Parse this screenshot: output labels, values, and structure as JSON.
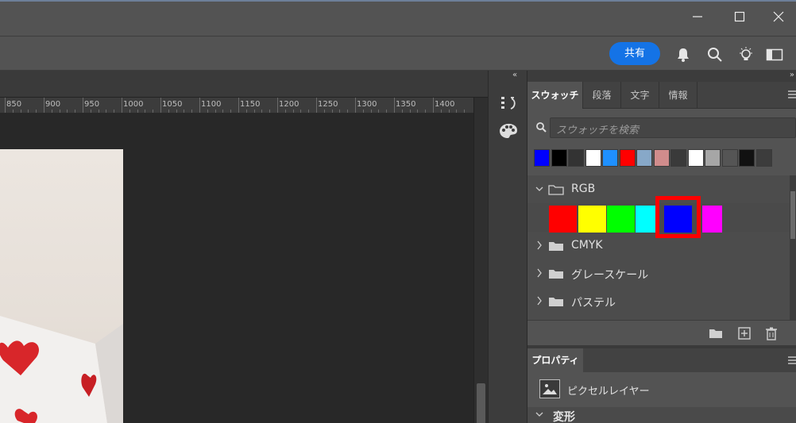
{
  "window": {
    "controls": {
      "minimize_icon": "minimize-icon",
      "maximize_icon": "maximize-icon",
      "close_icon": "close-icon"
    }
  },
  "optionsbar": {
    "share_label": "共有",
    "share_color": "#1473e6",
    "icons": [
      "bell-icon",
      "search-icon",
      "lightbulb-icon",
      "workspace-icon"
    ]
  },
  "ruler": {
    "labels": [
      "850",
      "900",
      "950",
      "1000",
      "1050",
      "1100",
      "1150",
      "1200",
      "1250",
      "1300",
      "1350",
      "1400"
    ]
  },
  "toolstrip": {
    "collapse_icon": "«",
    "icons": [
      "history-icon",
      "palette-icon"
    ]
  },
  "panel": {
    "collapse_icon": "»",
    "tabs": [
      {
        "label": "スウォッチ",
        "active": true
      },
      {
        "label": "段落",
        "active": false
      },
      {
        "label": "文字",
        "active": false
      },
      {
        "label": "情報",
        "active": false
      }
    ],
    "search_placeholder": "スウォッチを検索",
    "recent_swatches": [
      "#0000ff",
      "#000000",
      "#333333",
      "#ffffff",
      "#1e90ff",
      "#ff0000",
      "#87a8c8",
      "#d08c8c",
      "#3a3a3a",
      "#ffffff",
      "#a6a6a6",
      "#555555",
      "#111111",
      "#3c3c3c"
    ],
    "groups": [
      {
        "label": "RGB",
        "expanded": true,
        "swatches": [
          "#ff0000",
          "#ffff00",
          "#00ff00",
          "#00ffff",
          "#0000ff",
          "#ff00ff"
        ],
        "selected_index": 4
      },
      {
        "label": "CMYK",
        "expanded": false
      },
      {
        "label": "グレースケール",
        "expanded": false
      },
      {
        "label": "パステル",
        "expanded": false
      }
    ],
    "footer_icons": [
      "new-group-icon",
      "new-swatch-icon",
      "trash-icon"
    ]
  },
  "properties": {
    "tab_label": "プロパティ",
    "layer_type": "ピクセルレイヤー",
    "section_label": "変形"
  },
  "colors": {
    "highlight": "#ff0000",
    "heart": "#d8262a"
  }
}
